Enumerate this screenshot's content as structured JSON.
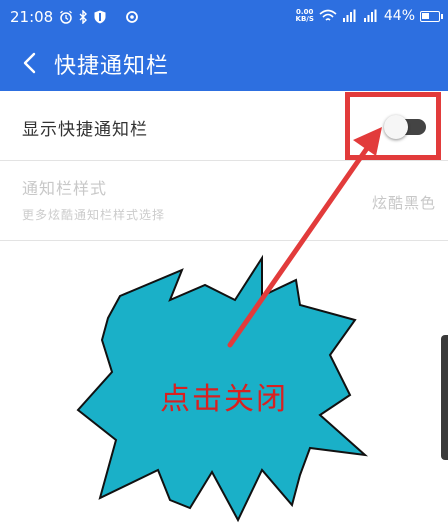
{
  "status_bar": {
    "time": "21:08",
    "network_speed_value": "0.00",
    "network_speed_unit": "KB/S",
    "battery_percent": "44%",
    "battery_level": 0.44,
    "icons": [
      "alarm-icon",
      "bluetooth-icon",
      "shield-icon",
      "sync-icon",
      "wifi-icon",
      "signal-4g-icon",
      "signal-3g-icon",
      "battery-icon"
    ]
  },
  "header": {
    "title": "快捷通知栏",
    "back_icon": "chevron-left-icon"
  },
  "settings": {
    "show_quick_bar": {
      "label": "显示快捷通知栏",
      "toggle_state": "off"
    },
    "notification_style": {
      "title": "通知栏样式",
      "subtitle": "更多炫酷通知栏样式选择",
      "value": "炫酷黑色"
    }
  },
  "annotation": {
    "callout_text": "点击关闭",
    "burst_color": "#1ab0c8",
    "text_color": "#d92020",
    "arrow_color": "#e23b3b",
    "highlight_color": "#e23b3b"
  },
  "colors": {
    "accent": "#2d6fe0"
  }
}
